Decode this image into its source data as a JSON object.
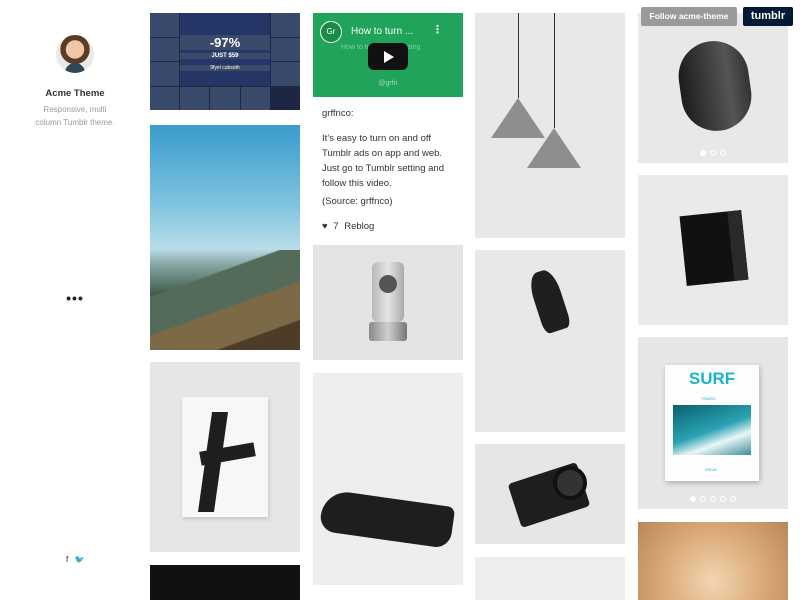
{
  "sidebar": {
    "title": "Acme Theme",
    "description": "Responsive, multi column Tumblr theme.",
    "more": "•••",
    "social": [
      "f",
      "🐦"
    ]
  },
  "tumblr_controls": {
    "follow_label": "Follow acme-theme",
    "tumblr_label": "tumblr"
  },
  "posts": {
    "ad": {
      "percent": "-97%",
      "text": "JUST $59",
      "brand": "9fyel cubsoth"
    },
    "video": {
      "channel_icon": "Gr",
      "title": "How to turn ...",
      "background_text": "How to turn ... advertising",
      "brand": "@grfn"
    },
    "text_post": {
      "source": "grffnco:",
      "body": "It’s easy to turn on and off Tumblr ads on app and web. Just go to Tumblr setting and follow this video.",
      "credit": "(Source: grffnco)",
      "likes": "7",
      "reblog": "Reblog"
    },
    "magazine": {
      "title": "SURF",
      "label": "TRAVEL",
      "issue": "ISSUE"
    }
  },
  "icons": {
    "avatar": "user-avatar",
    "more": "more-dots-icon",
    "facebook": "facebook-icon",
    "twitter": "twitter-icon",
    "heart": "heart-icon",
    "play": "play-icon"
  }
}
